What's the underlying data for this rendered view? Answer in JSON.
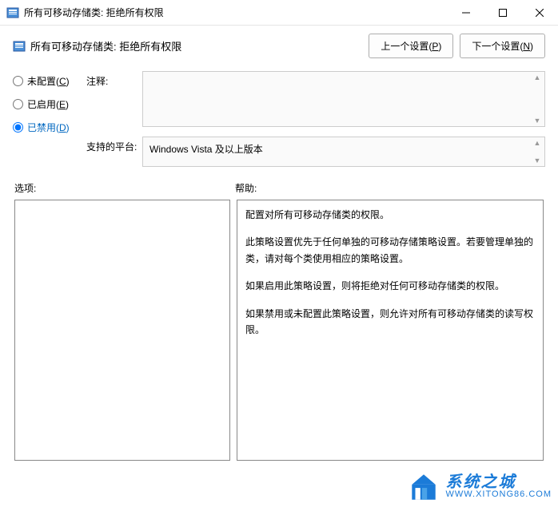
{
  "titlebar": {
    "text": "所有可移动存储类: 拒绝所有权限"
  },
  "subheader": {
    "text": "所有可移动存储类: 拒绝所有权限"
  },
  "nav": {
    "prev_prefix": "上一个设置(",
    "prev_key": "P",
    "prev_suffix": ")",
    "next_prefix": "下一个设置(",
    "next_key": "N",
    "next_suffix": ")"
  },
  "radios": {
    "not_configured_prefix": "未配置(",
    "not_configured_key": "C",
    "not_configured_suffix": ")",
    "enabled_prefix": "已启用(",
    "enabled_key": "E",
    "enabled_suffix": ")",
    "disabled_prefix": "已禁用(",
    "disabled_key": "D",
    "disabled_suffix": ")",
    "selected": "disabled"
  },
  "labels": {
    "comment": "注释:",
    "platform": "支持的平台:",
    "options": "选项:",
    "help": "帮助:"
  },
  "platform_text": "Windows Vista 及以上版本",
  "help": {
    "p1": "配置对所有可移动存储类的权限。",
    "p2": "此策略设置优先于任何单独的可移动存储策略设置。若要管理单独的类，请对每个类使用相应的策略设置。",
    "p3": "如果启用此策略设置，则将拒绝对任何可移动存储类的权限。",
    "p4": "如果禁用或未配置此策略设置，则允许对所有可移动存储类的读写权限。"
  },
  "watermark": {
    "cn": "系统之城",
    "en": "WWW.XITONG86.COM"
  }
}
